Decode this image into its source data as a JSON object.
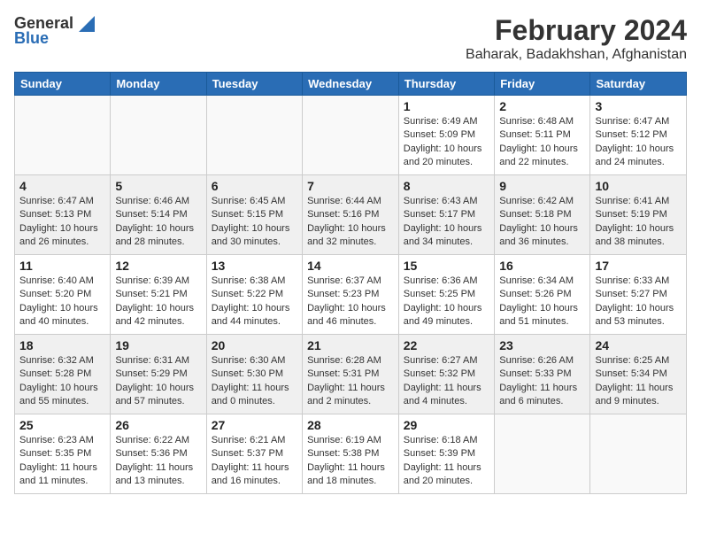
{
  "logo": {
    "general": "General",
    "blue": "Blue"
  },
  "title": {
    "month": "February 2024",
    "location": "Baharak, Badakhshan, Afghanistan"
  },
  "weekdays": [
    "Sunday",
    "Monday",
    "Tuesday",
    "Wednesday",
    "Thursday",
    "Friday",
    "Saturday"
  ],
  "weeks": [
    [
      {
        "day": "",
        "info": ""
      },
      {
        "day": "",
        "info": ""
      },
      {
        "day": "",
        "info": ""
      },
      {
        "day": "",
        "info": ""
      },
      {
        "day": "1",
        "info": "Sunrise: 6:49 AM\nSunset: 5:09 PM\nDaylight: 10 hours\nand 20 minutes."
      },
      {
        "day": "2",
        "info": "Sunrise: 6:48 AM\nSunset: 5:11 PM\nDaylight: 10 hours\nand 22 minutes."
      },
      {
        "day": "3",
        "info": "Sunrise: 6:47 AM\nSunset: 5:12 PM\nDaylight: 10 hours\nand 24 minutes."
      }
    ],
    [
      {
        "day": "4",
        "info": "Sunrise: 6:47 AM\nSunset: 5:13 PM\nDaylight: 10 hours\nand 26 minutes."
      },
      {
        "day": "5",
        "info": "Sunrise: 6:46 AM\nSunset: 5:14 PM\nDaylight: 10 hours\nand 28 minutes."
      },
      {
        "day": "6",
        "info": "Sunrise: 6:45 AM\nSunset: 5:15 PM\nDaylight: 10 hours\nand 30 minutes."
      },
      {
        "day": "7",
        "info": "Sunrise: 6:44 AM\nSunset: 5:16 PM\nDaylight: 10 hours\nand 32 minutes."
      },
      {
        "day": "8",
        "info": "Sunrise: 6:43 AM\nSunset: 5:17 PM\nDaylight: 10 hours\nand 34 minutes."
      },
      {
        "day": "9",
        "info": "Sunrise: 6:42 AM\nSunset: 5:18 PM\nDaylight: 10 hours\nand 36 minutes."
      },
      {
        "day": "10",
        "info": "Sunrise: 6:41 AM\nSunset: 5:19 PM\nDaylight: 10 hours\nand 38 minutes."
      }
    ],
    [
      {
        "day": "11",
        "info": "Sunrise: 6:40 AM\nSunset: 5:20 PM\nDaylight: 10 hours\nand 40 minutes."
      },
      {
        "day": "12",
        "info": "Sunrise: 6:39 AM\nSunset: 5:21 PM\nDaylight: 10 hours\nand 42 minutes."
      },
      {
        "day": "13",
        "info": "Sunrise: 6:38 AM\nSunset: 5:22 PM\nDaylight: 10 hours\nand 44 minutes."
      },
      {
        "day": "14",
        "info": "Sunrise: 6:37 AM\nSunset: 5:23 PM\nDaylight: 10 hours\nand 46 minutes."
      },
      {
        "day": "15",
        "info": "Sunrise: 6:36 AM\nSunset: 5:25 PM\nDaylight: 10 hours\nand 49 minutes."
      },
      {
        "day": "16",
        "info": "Sunrise: 6:34 AM\nSunset: 5:26 PM\nDaylight: 10 hours\nand 51 minutes."
      },
      {
        "day": "17",
        "info": "Sunrise: 6:33 AM\nSunset: 5:27 PM\nDaylight: 10 hours\nand 53 minutes."
      }
    ],
    [
      {
        "day": "18",
        "info": "Sunrise: 6:32 AM\nSunset: 5:28 PM\nDaylight: 10 hours\nand 55 minutes."
      },
      {
        "day": "19",
        "info": "Sunrise: 6:31 AM\nSunset: 5:29 PM\nDaylight: 10 hours\nand 57 minutes."
      },
      {
        "day": "20",
        "info": "Sunrise: 6:30 AM\nSunset: 5:30 PM\nDaylight: 11 hours\nand 0 minutes."
      },
      {
        "day": "21",
        "info": "Sunrise: 6:28 AM\nSunset: 5:31 PM\nDaylight: 11 hours\nand 2 minutes."
      },
      {
        "day": "22",
        "info": "Sunrise: 6:27 AM\nSunset: 5:32 PM\nDaylight: 11 hours\nand 4 minutes."
      },
      {
        "day": "23",
        "info": "Sunrise: 6:26 AM\nSunset: 5:33 PM\nDaylight: 11 hours\nand 6 minutes."
      },
      {
        "day": "24",
        "info": "Sunrise: 6:25 AM\nSunset: 5:34 PM\nDaylight: 11 hours\nand 9 minutes."
      }
    ],
    [
      {
        "day": "25",
        "info": "Sunrise: 6:23 AM\nSunset: 5:35 PM\nDaylight: 11 hours\nand 11 minutes."
      },
      {
        "day": "26",
        "info": "Sunrise: 6:22 AM\nSunset: 5:36 PM\nDaylight: 11 hours\nand 13 minutes."
      },
      {
        "day": "27",
        "info": "Sunrise: 6:21 AM\nSunset: 5:37 PM\nDaylight: 11 hours\nand 16 minutes."
      },
      {
        "day": "28",
        "info": "Sunrise: 6:19 AM\nSunset: 5:38 PM\nDaylight: 11 hours\nand 18 minutes."
      },
      {
        "day": "29",
        "info": "Sunrise: 6:18 AM\nSunset: 5:39 PM\nDaylight: 11 hours\nand 20 minutes."
      },
      {
        "day": "",
        "info": ""
      },
      {
        "day": "",
        "info": ""
      }
    ]
  ],
  "row_shading": [
    false,
    true,
    false,
    true,
    false
  ]
}
